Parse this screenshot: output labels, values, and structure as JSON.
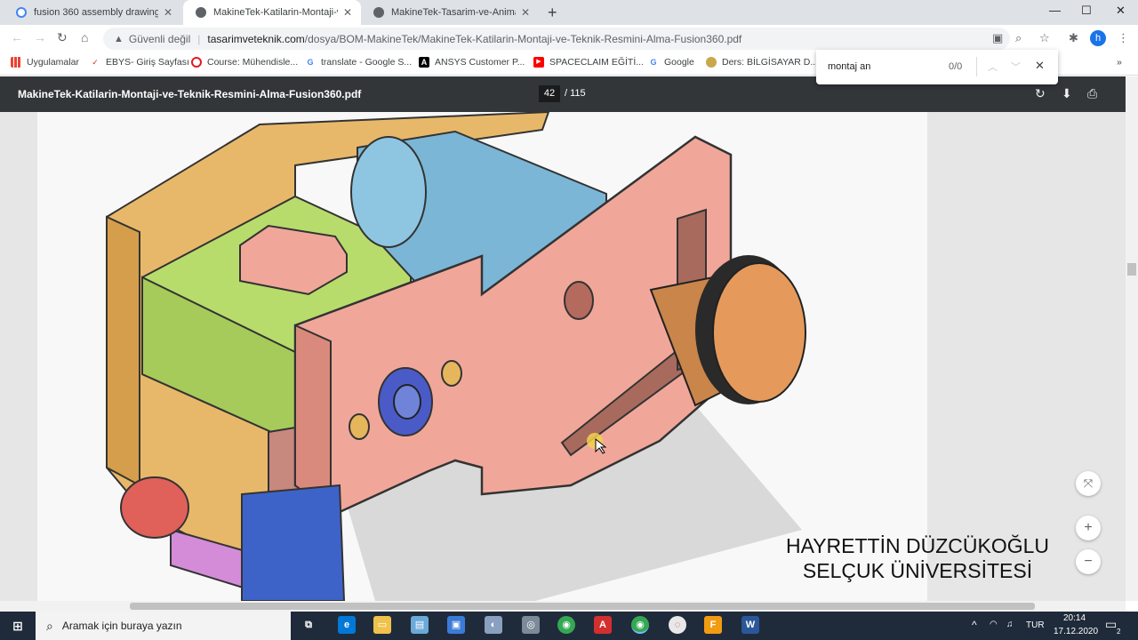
{
  "tabs": [
    {
      "title": "fusion 360 assembly drawing m...",
      "icon": "google-g-icon",
      "active": false
    },
    {
      "title": "MakineTek-Katilarin-Montaji-ve-...",
      "icon": "globe-icon",
      "active": true
    },
    {
      "title": "MakineTek-Tasarim-ve-Animasyo...",
      "icon": "globe-icon",
      "active": false
    }
  ],
  "new_tab": "+",
  "window_controls": {
    "minimize": "—",
    "maximize": "☐",
    "close": "✕"
  },
  "address": {
    "security_label": "Güvenli değil",
    "host": "tasarimveteknik.com",
    "path": "/dosya/BOM-MakineTek/MakineTek-Katilarin-Montaji-ve-Teknik-Resmini-Alma-Fusion360.pdf"
  },
  "profile_initial": "h",
  "bookmarks": [
    {
      "label": "Uygulamalar",
      "icon": "apps-grid-icon",
      "color": "#ea4335"
    },
    {
      "label": "EBYS- Giriş Sayfası",
      "icon": "checkmark-icon",
      "color": "#d93025"
    },
    {
      "label": "Course: Mühendisle...",
      "icon": "opera-icon",
      "color": "#e31b23"
    },
    {
      "label": "translate - Google S...",
      "icon": "google-g-icon",
      "color": "#4285f4"
    },
    {
      "label": "ANSYS Customer P...",
      "icon": "ansys-icon",
      "color": "#000000"
    },
    {
      "label": "SPACECLAIM EĞİTİ...",
      "icon": "youtube-icon",
      "color": "#ff0000"
    },
    {
      "label": "Google",
      "icon": "google-g-icon",
      "color": "#4285f4"
    },
    {
      "label": "Ders: BİLGİSAYAR D...",
      "icon": "course-icon",
      "color": "#c8a84b"
    }
  ],
  "bookmarks_overflow": "»",
  "find": {
    "query": "montaj an",
    "count": "0/0"
  },
  "pdf": {
    "filename": "MakineTek-Katilarin-Montaji-ve-Teknik-Resmini-Alma-Fusion360.pdf",
    "page": "42",
    "total": "/ 115"
  },
  "zoom": {
    "fit": "⤧",
    "plus": "+",
    "minus": "−"
  },
  "credit": {
    "line1": "HAYRETTİN DÜZCÜKOĞLU",
    "line2": "SELÇUK ÜNİVERSİTESİ"
  },
  "taskbar": {
    "search_placeholder": "Aramak için buraya yazın",
    "lang": "TUR",
    "time": "20:14",
    "date": "17.12.2020",
    "notification_count": "2"
  },
  "colors": {
    "part_yellow": "#e8b86a",
    "part_green": "#b8dc6c",
    "part_blue": "#7bb6d6",
    "part_pink": "#f0a79a",
    "part_orange": "#e59a5c",
    "part_red": "#e0605a",
    "part_purple": "#d48cd8"
  }
}
